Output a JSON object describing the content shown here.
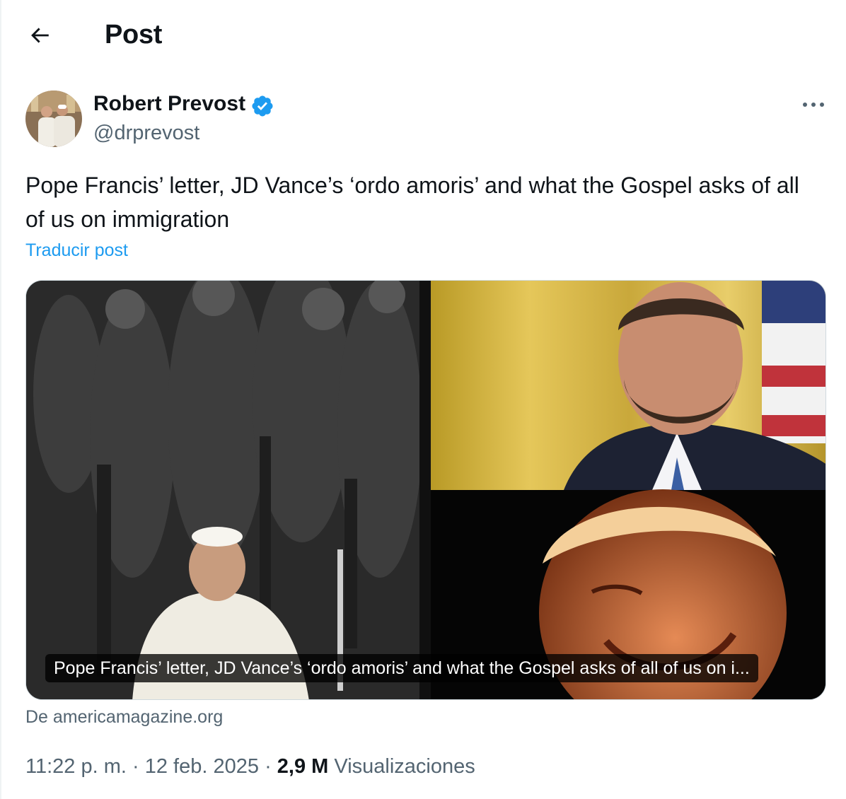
{
  "header": {
    "title": "Post",
    "back_icon": "arrow-left-icon"
  },
  "author": {
    "display_name": "Robert Prevost",
    "handle": "@drprevost",
    "verified_icon": "verified-badge-icon",
    "verified_color": "#1d9bf0"
  },
  "post": {
    "text": "Pope Francis’ letter, JD Vance’s ‘ordo amoris’ and what the Gospel asks of all of us on immigration",
    "translate_label": "Traducir post"
  },
  "link_card": {
    "caption": "Pope Francis’ letter, JD Vance’s ‘ordo amoris’ and what the Gospel asks of all of us on i...",
    "source": "De americamagazine.org"
  },
  "meta": {
    "time": "11:22 p. m.",
    "separator": "·",
    "date": "12 feb. 2025",
    "views_count": "2,9 M",
    "views_label": "Visualizaciones"
  },
  "colors": {
    "text_primary": "#0f1419",
    "text_secondary": "#536471",
    "accent": "#1d9bf0",
    "border": "#cfd9de"
  },
  "icons": {
    "more": "more-horizontal-icon"
  }
}
